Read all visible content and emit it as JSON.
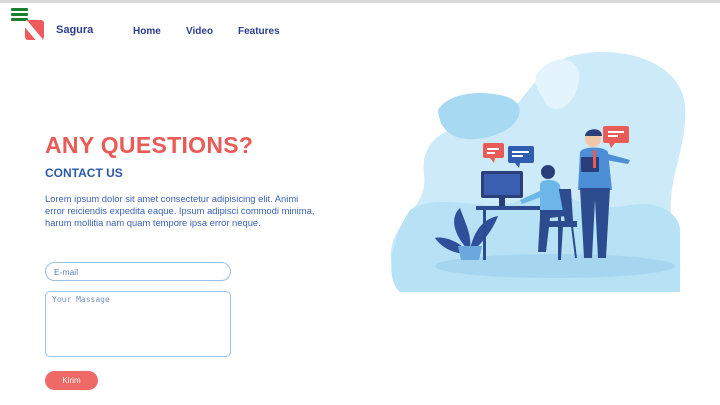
{
  "header": {
    "brand": "Sagura",
    "nav": [
      {
        "label": "Home"
      },
      {
        "label": "Video"
      },
      {
        "label": "Features"
      }
    ]
  },
  "hero": {
    "title": "ANY QUESTIONS?",
    "subtitle": "CONTACT US",
    "description": "Lorem ipsum dolor sit amet consectetur adipisicing elit. Animi error reiciendis expedita eaque. Ipsum adipisci commodi minima, harum mollitia nam quam tempore ipsa error neque."
  },
  "form": {
    "email_placeholder": "E-mail",
    "message_placeholder": "Your Massage",
    "submit_label": "Kirim"
  },
  "colors": {
    "accent": "#e85b57",
    "brand_blue": "#2b3d8f",
    "text_blue": "#3a63b0",
    "illustration_light": "#c9e8f6"
  },
  "icons": {
    "menu": "hamburger-menu-icon",
    "logo": "sagura-logo-icon"
  }
}
